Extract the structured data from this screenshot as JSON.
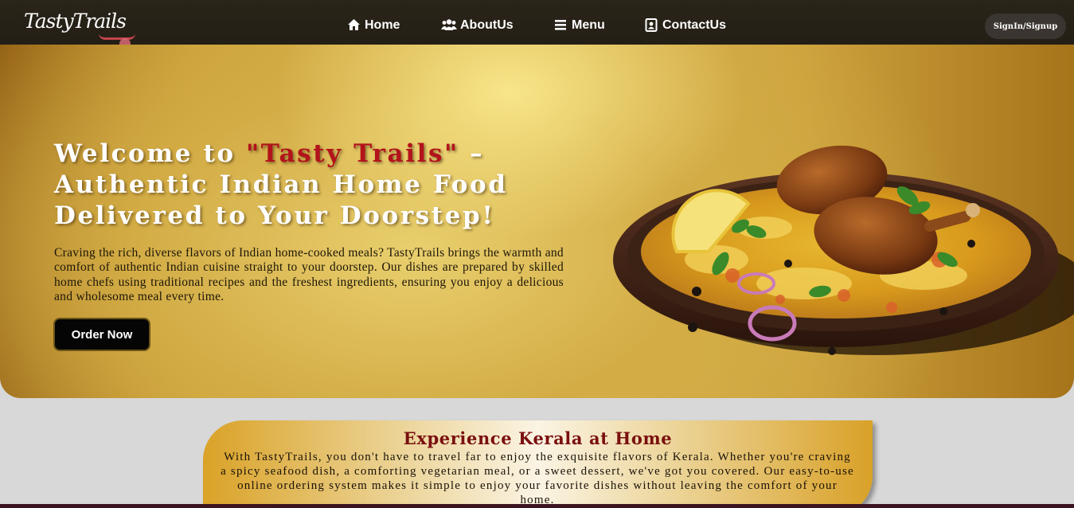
{
  "navbar": {
    "logo_text": "TastyTrails",
    "links": [
      {
        "label": "Home",
        "icon": "home-icon"
      },
      {
        "label": "AboutUs",
        "icon": "users-icon"
      },
      {
        "label": "Menu",
        "icon": "menu-icon"
      },
      {
        "label": "ContactUs",
        "icon": "contact-card-icon"
      }
    ],
    "signin_label": "SignIn/Signup"
  },
  "hero": {
    "title_prefix": "Welcome to ",
    "title_brand": "\"Tasty Trails\"",
    "title_suffix": " – Authentic Indian Home Food Delivered to Your Doorstep!",
    "description": "Craving the rich, diverse flavors of Indian home-cooked meals? TastyTrails brings the warmth and comfort of authentic Indian cuisine straight to your doorstep. Our dishes are prepared by skilled home chefs using traditional recipes and the freshest ingredients, ensuring you enjoy a delicious and wholesome meal every time.",
    "order_button": "Order Now",
    "image": "biryani-plate"
  },
  "kerala": {
    "title": "Experience Kerala at Home",
    "text": "With TastyTrails, you don't have to travel far to enjoy the exquisite flavors of Kerala. Whether you're craving a spicy seafood dish, a comforting vegetarian meal, or a sweet dessert, we've got you covered. Our easy-to-use online ordering system makes it simple to enjoy your favorite dishes without leaving the comfort of your home."
  },
  "colors": {
    "navbar_bg": "#231e15",
    "brand_red": "#b3131b",
    "gold": "#d3ac45",
    "kerala_title": "#7a0f0f"
  }
}
